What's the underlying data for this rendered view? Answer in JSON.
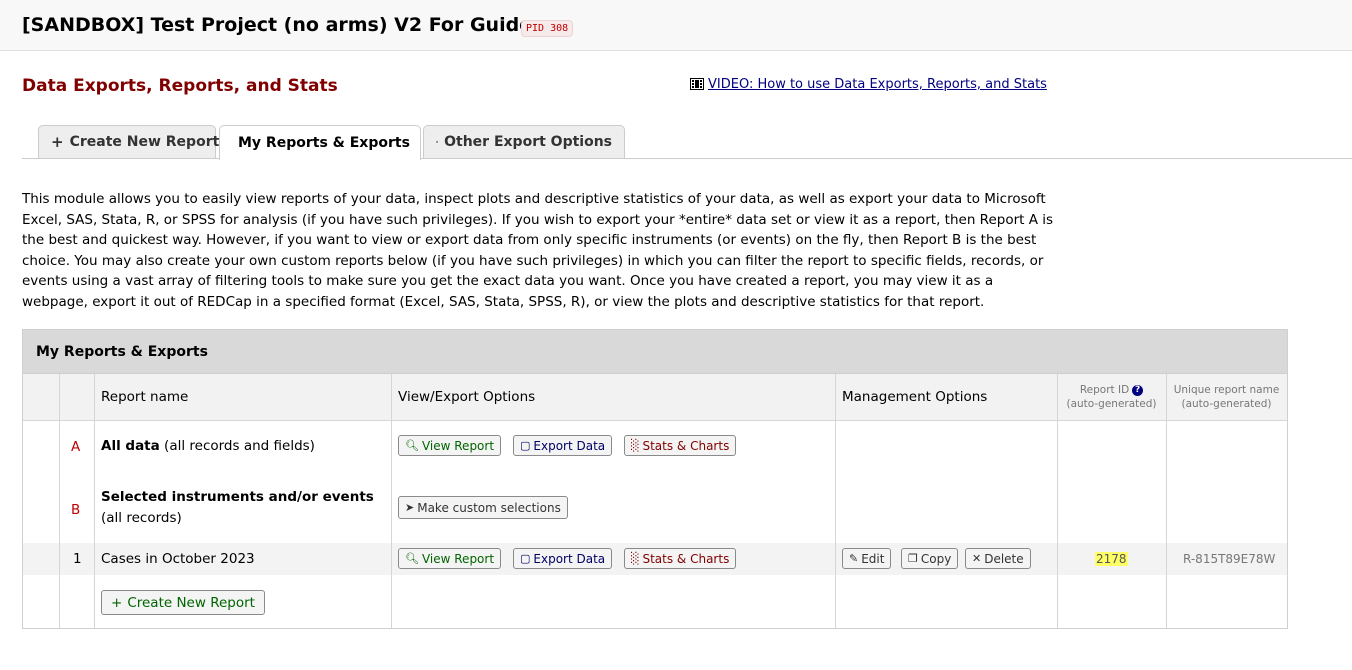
{
  "header": {
    "project_title": "[SANDBOX] Test Project (no arms) V2 For Guide",
    "pid_badge": "PID 308"
  },
  "page": {
    "heading": "Data Exports, Reports, and Stats",
    "video_link": "VIDEO: How to use Data Exports, Reports, and Stats"
  },
  "tabs": [
    {
      "label": "Create New Report",
      "icon": "plus-icon"
    },
    {
      "label": "My Reports & Exports",
      "icon": "file-export-icon",
      "active": true
    },
    {
      "label": "Other Export Options",
      "icon": "share-box-icon"
    }
  ],
  "intro_text": "This module allows you to easily view reports of your data, inspect plots and descriptive statistics of your data, as well as export your data to Microsoft Excel, SAS, Stata, R, or SPSS for analysis (if you have such privileges). If you wish to export your *entire* data set or view it as a report, then Report A is the best and quickest way. However, if you want to view or export data from only specific instruments (or events) on the fly, then Report B is the best choice. You may also create your own custom reports below (if you have such privileges) in which you can filter the report to specific fields, records, or events using a vast array of filtering tools to make sure you get the exact data you want. Once you have created a report, you may view it as a webpage, export it out of REDCap in a specified format (Excel, SAS, Stata, SPSS, R), or view the plots and descriptive statistics for that report.",
  "reports_panel": {
    "title": "My Reports & Exports",
    "columns": {
      "report_name": "Report name",
      "view_export": "View/Export Options",
      "management": "Management Options",
      "report_id": "Report ID",
      "report_id_sub": "(auto-generated)",
      "unique_name": "Unique report name",
      "unique_name_sub": "(auto-generated)"
    },
    "rows": {
      "a": {
        "letter": "A",
        "name_bold": "All data",
        "name_rest": "(all records and fields)"
      },
      "b": {
        "letter": "B",
        "name_bold": "Selected instruments and/or events",
        "name_rest": "(all records)",
        "button": "Make custom selections"
      },
      "r1": {
        "number": "1",
        "name": "Cases in October 2023",
        "report_id": "2178",
        "unique_name": "R-815T89E78W"
      }
    },
    "buttons": {
      "view_report": "View Report",
      "export_data": "Export Data",
      "stats_charts": "Stats & Charts",
      "edit": "Edit",
      "copy": "Copy",
      "delete": "Delete",
      "create_new_report": "Create New Report"
    }
  },
  "colors": {
    "heading": "#800000",
    "highlight": "#ffff66",
    "link": "#000080"
  }
}
